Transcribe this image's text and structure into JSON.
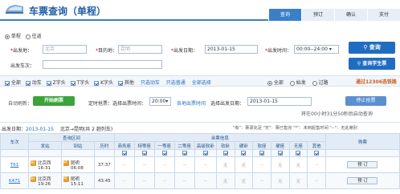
{
  "header": {
    "title": "车票查询（单程）",
    "steps": [
      "查询",
      "预订",
      "确认",
      "支付"
    ],
    "active_step": 0
  },
  "trip_type": {
    "one_way": "单程",
    "round_trip": "往返"
  },
  "form": {
    "from_label": "出发地：",
    "from_value": "北京",
    "to_label": "目的地：",
    "to_value": "昆明",
    "date_label": "出发日期：",
    "date_value": "2013-01-15",
    "time_label": "出发时间：",
    "time_value": "00:00--24:00",
    "train_label": "出发车次：",
    "query_button": "查询",
    "student_button": "查询学生票"
  },
  "filters": {
    "types": [
      "全部",
      "动车",
      "Z字头",
      "T字头",
      "K字头",
      "其他"
    ],
    "links": [
      "只选动车",
      "只选普通",
      "全部选择"
    ],
    "pass": [
      "全部",
      "始发",
      "过路"
    ],
    "notice": "通过12306选铁路"
  },
  "auto": {
    "label": "自动刷新：",
    "start_button": "开始刷票",
    "timed_label": "定时抢票：选择出票时间：",
    "timed_value": "20:00",
    "watch_label": "各地出票时间",
    "date_label": "选择出发日期：",
    "date_value": "2013-01-15",
    "stop_button": "停止抢票",
    "countdown": "将在00小时31分50秒后启动查询"
  },
  "info": {
    "date_label": "出发日期：",
    "date_value": "2013-01-15",
    "route": "北京→昆明(共 2 趟列车)",
    "legend": "\"有\"：票源充足  \"无\"：票已售完  \"*\"：未到起售时间  \"--\"：无此席别"
  },
  "table": {
    "group_headers": [
      "车次",
      "查询区间",
      "余票信息",
      "购票"
    ],
    "sub_headers": [
      "发站",
      "到站",
      "历时",
      "商务座",
      "特等座",
      "一等座",
      "二等座",
      "高级软卧",
      "软卧",
      "硬卧",
      "软座",
      "硬座",
      "无座",
      "其他"
    ],
    "rows": [
      {
        "train": "T61",
        "from": "北京西",
        "from_time": "16:31",
        "to": "昆明",
        "to_time": "06:08",
        "duration": "37:37",
        "seats": [
          "--",
          "--",
          "--",
          "--",
          "--",
          "无",
          "无",
          "--",
          "无",
          "无",
          "--"
        ],
        "book": "预 订"
      },
      {
        "train": "K471",
        "from": "北京西",
        "from_time": "19:26",
        "to": "昆明",
        "to_time": "15:11",
        "duration": "43:45",
        "seats": [
          "--",
          "--",
          "--",
          "--",
          "--",
          "无",
          "无",
          "--",
          "无",
          "无",
          "--"
        ],
        "book": "预 订"
      }
    ],
    "from_tag": "始",
    "to_tag": "终"
  }
}
